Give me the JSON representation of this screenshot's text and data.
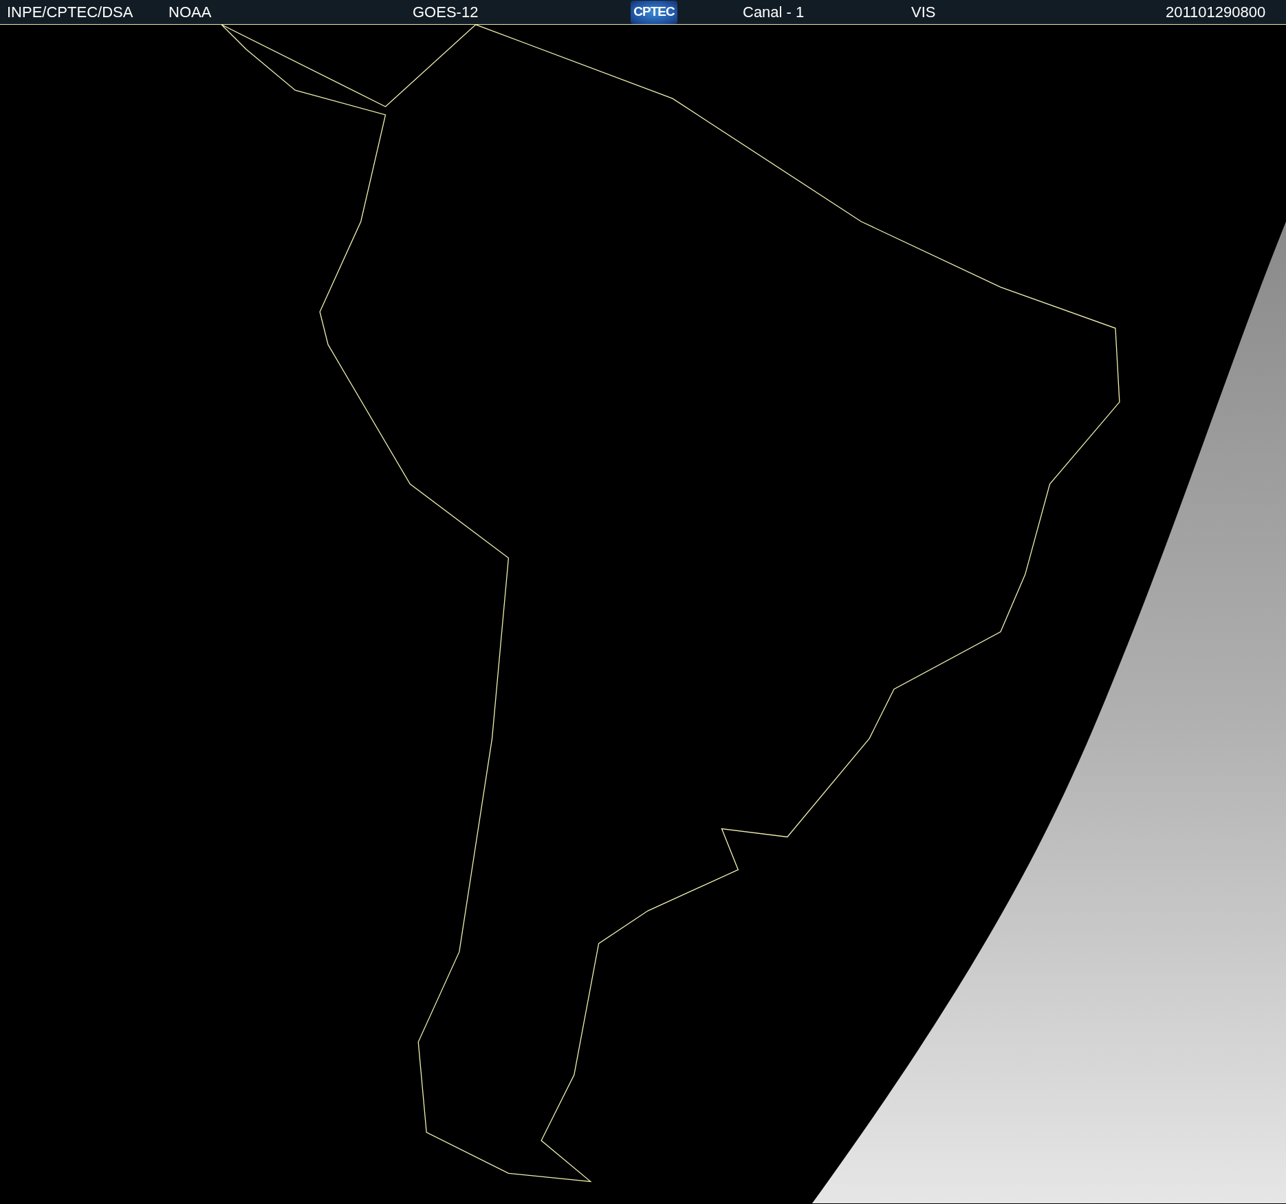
{
  "header": {
    "items": [
      {
        "kind": "text",
        "text": "INPE/CPTEC/DSA"
      },
      {
        "kind": "text",
        "text": "NOAA"
      },
      {
        "kind": "text",
        "text": "GOES-12"
      },
      {
        "kind": "logo",
        "text": "CPTEC"
      },
      {
        "kind": "text",
        "text": "Canal - 1"
      },
      {
        "kind": "text",
        "text": "VIS"
      },
      {
        "kind": "text",
        "text": "201101290800"
      }
    ]
  }
}
